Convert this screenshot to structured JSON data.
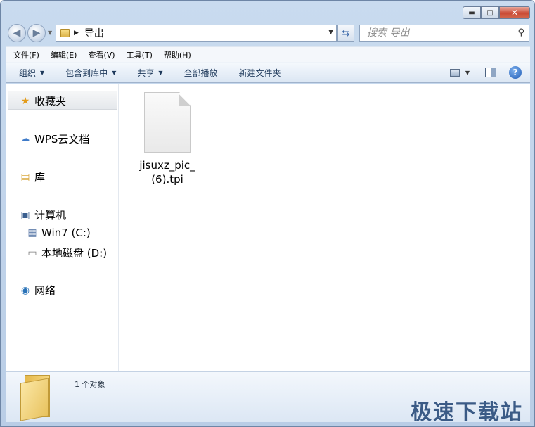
{
  "window": {
    "minimize_glyph": "▬",
    "maximize_glyph": "□",
    "close_glyph": "✕"
  },
  "navigation": {
    "back_glyph": "◀",
    "forward_glyph": "▶",
    "address_path": "导出",
    "search_placeholder": "搜索 导出"
  },
  "menu": [
    "文件(F)",
    "编辑(E)",
    "查看(V)",
    "工具(T)",
    "帮助(H)"
  ],
  "commands": {
    "organize": "组织",
    "include_in_library": "包含到库中",
    "share": "共享",
    "play_all": "全部播放",
    "new_folder": "新建文件夹",
    "help": "?"
  },
  "sidebar": {
    "favorites": "收藏夹",
    "wps_cloud": "WPS云文档",
    "libraries": "库",
    "computer": "计算机",
    "drive_c": "Win7 (C:)",
    "drive_d": "本地磁盘 (D:)",
    "network": "网络"
  },
  "files": [
    {
      "name": "jisuxz_pic_(6).tpi"
    }
  ],
  "details": {
    "object_count": "1 个对象"
  },
  "watermark": "极速下载站",
  "colors": {
    "window_frame": "#b9cde6",
    "close_button": "#c94a35",
    "watermark": "#3b5b86"
  }
}
